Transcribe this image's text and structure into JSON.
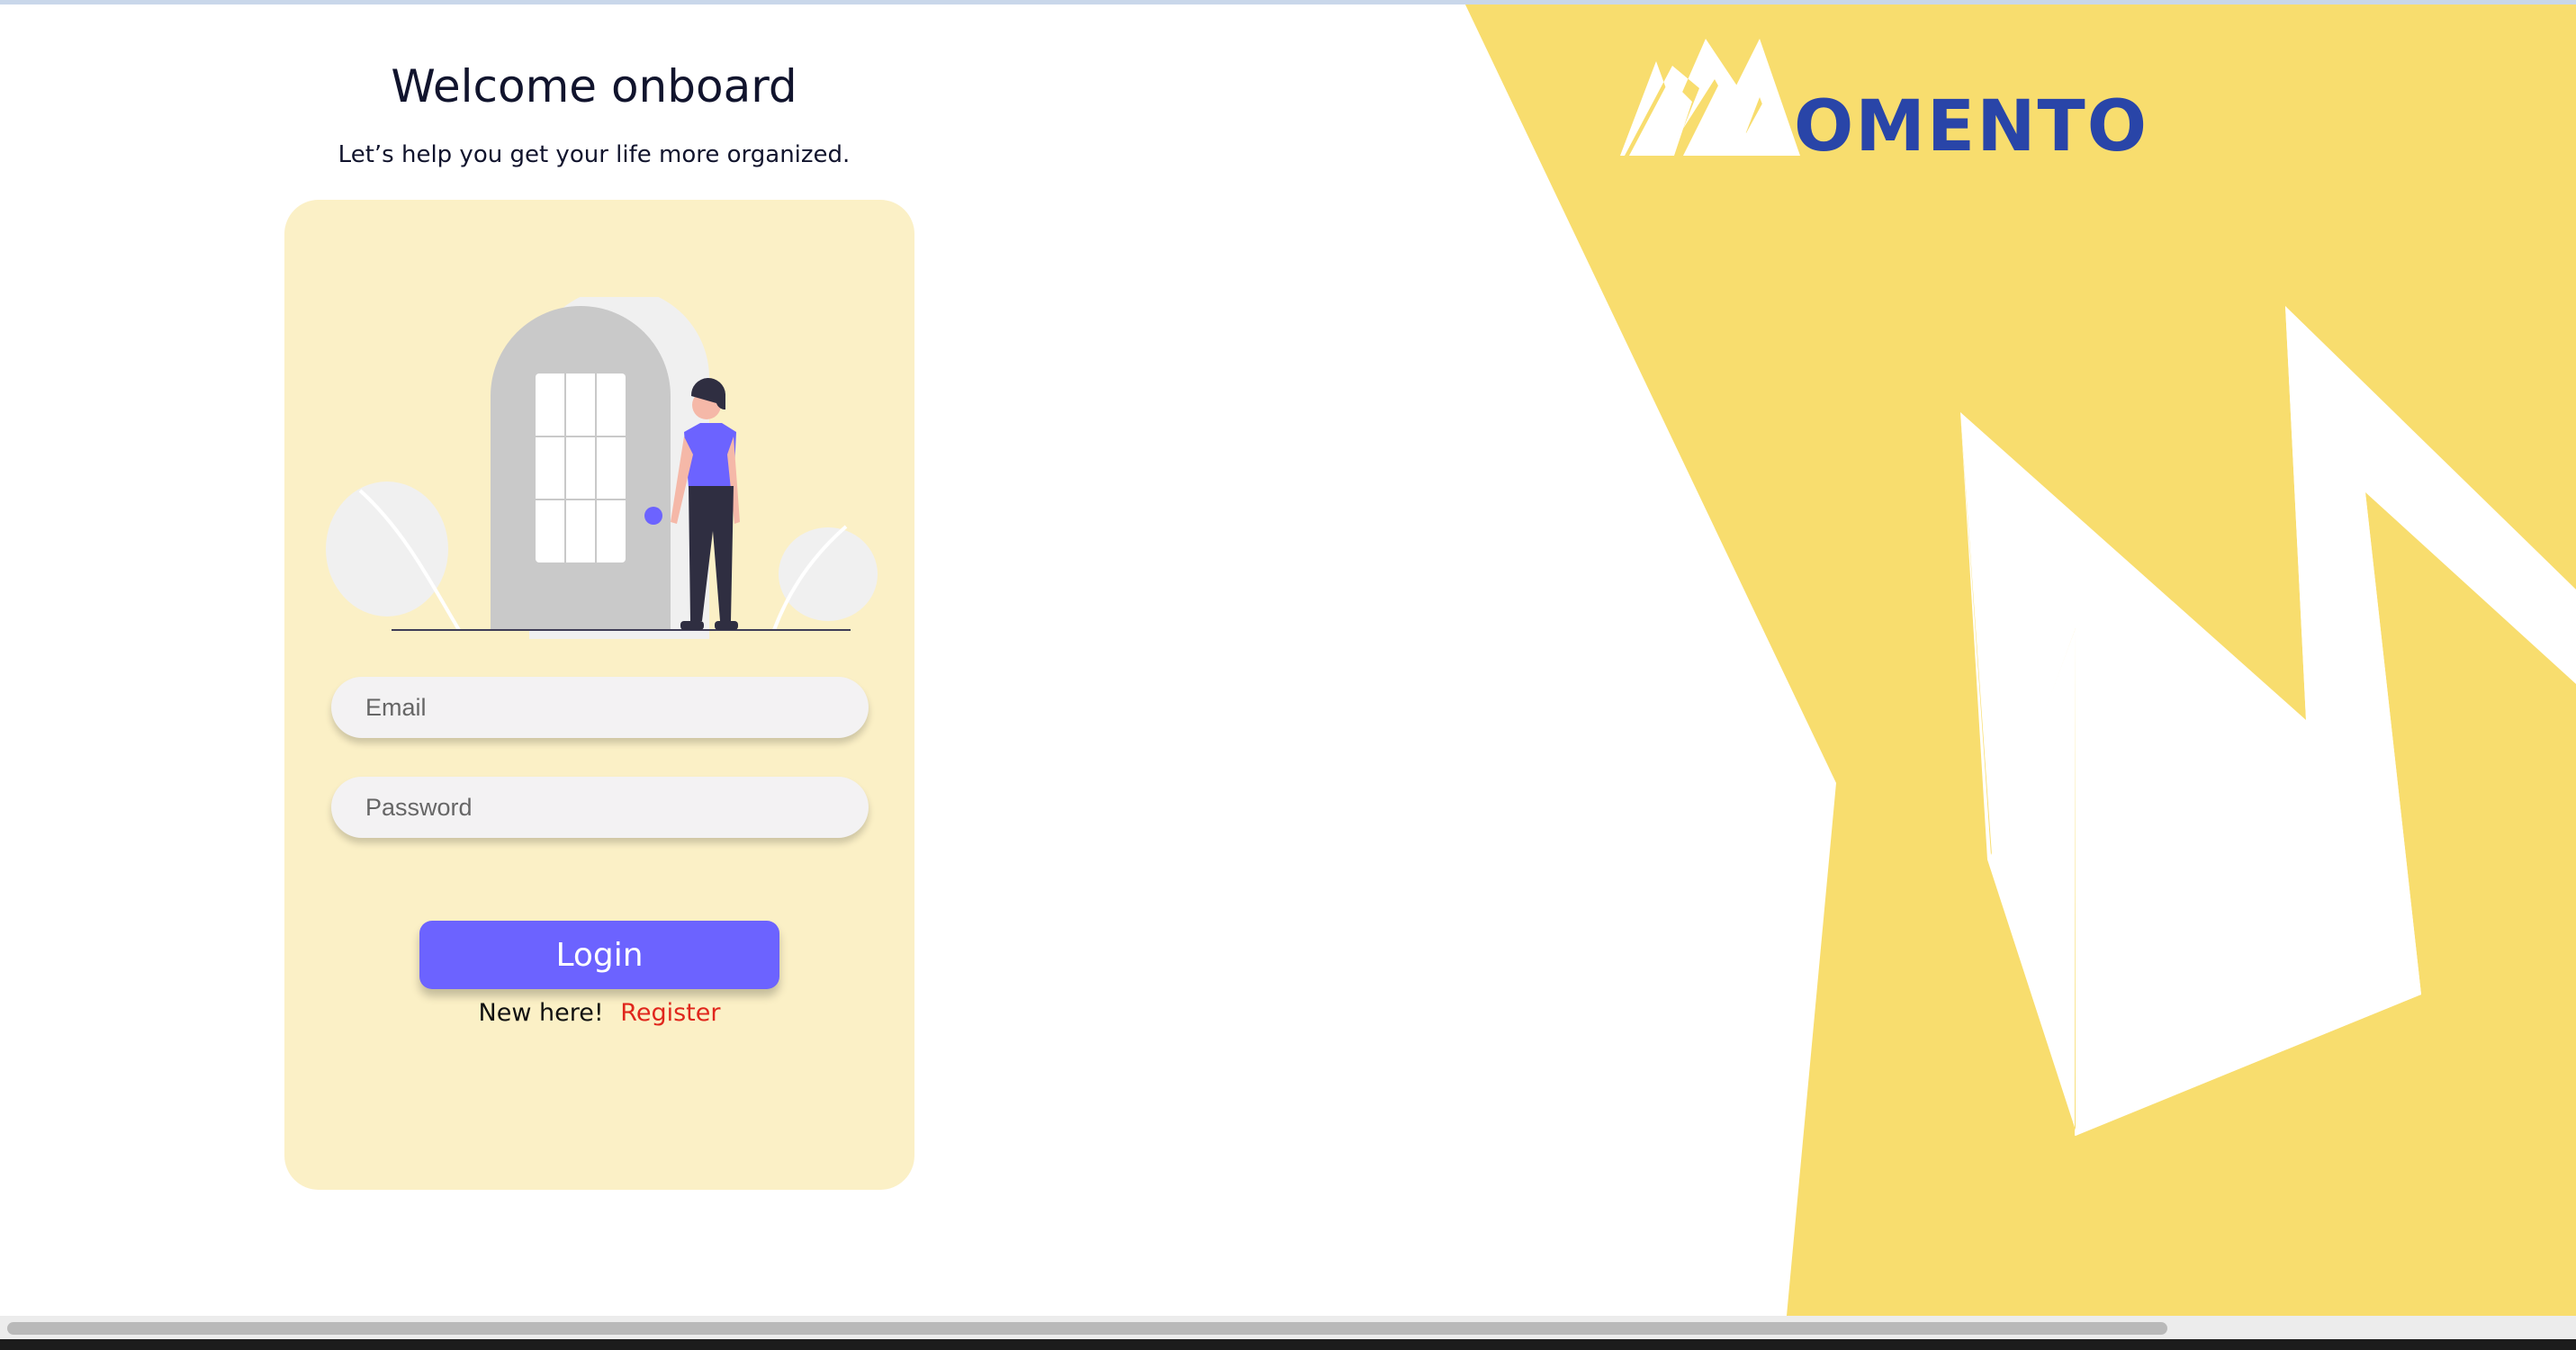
{
  "header": {
    "title": "Welcome onboard",
    "subtitle": "Let’s help you get your life more organized."
  },
  "brand": {
    "logo_text": "OMENTO",
    "accent_yellow": "#f8dd6e",
    "logo_blue": "#2945a8"
  },
  "login_form": {
    "email_placeholder": "Email",
    "password_placeholder": "Password",
    "login_label": "Login",
    "new_here_text": "New here!",
    "register_label": "Register",
    "button_color": "#6c63ff",
    "card_color": "#fbf0c6",
    "register_color": "#e0261c"
  },
  "icons": {
    "illustration": "person-at-door-illustration",
    "logo": "mountain-m-logo"
  }
}
